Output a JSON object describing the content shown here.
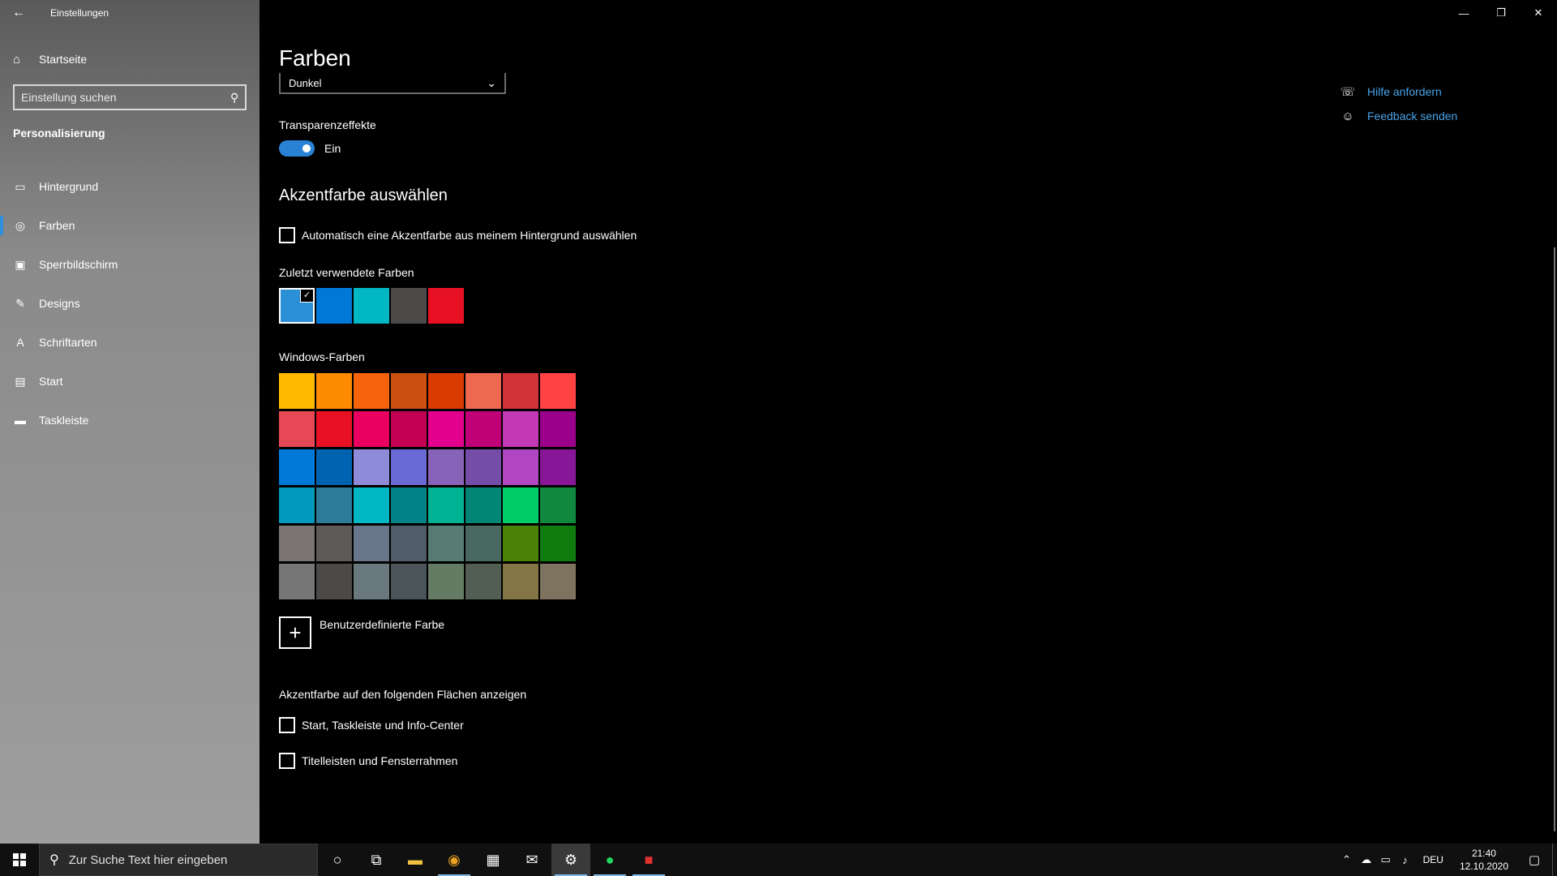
{
  "window": {
    "title": "Einstellungen",
    "controls": {
      "minimize": "—",
      "restore": "❐",
      "close": "✕"
    }
  },
  "sidebar": {
    "home_label": "Startseite",
    "search_placeholder": "Einstellung suchen",
    "section_heading": "Personalisierung",
    "items": [
      {
        "label": "Hintergrund",
        "icon": "image-icon",
        "glyph": "▭"
      },
      {
        "label": "Farben",
        "icon": "palette-icon",
        "glyph": "◎",
        "active": true
      },
      {
        "label": "Sperrbildschirm",
        "icon": "lock-screen-icon",
        "glyph": "▣"
      },
      {
        "label": "Designs",
        "icon": "brush-icon",
        "glyph": "✎"
      },
      {
        "label": "Schriftarten",
        "icon": "font-icon",
        "glyph": "A"
      },
      {
        "label": "Start",
        "icon": "start-icon",
        "glyph": "▤"
      },
      {
        "label": "Taskleiste",
        "icon": "taskbar-icon",
        "glyph": "▬"
      }
    ]
  },
  "main": {
    "title": "Farben",
    "mode_dropdown": {
      "value": "Dunkel"
    },
    "transparency": {
      "label": "Transparenzeffekte",
      "state_label": "Ein",
      "on": true
    },
    "accent_heading": "Akzentfarbe auswählen",
    "auto_accent_label": "Automatisch eine Akzentfarbe aus meinem Hintergrund auswählen",
    "recent_label": "Zuletzt verwendete Farben",
    "recent_colors": [
      "#2b8fd6",
      "#0078d7",
      "#00b7c3",
      "#4c4a48",
      "#e81123"
    ],
    "windows_colors_label": "Windows-Farben",
    "windows_colors": [
      "#ffb900",
      "#ff8c00",
      "#f7630c",
      "#ca5010",
      "#da3b01",
      "#ef6950",
      "#d13438",
      "#ff4343",
      "#e74856",
      "#e81123",
      "#ea005e",
      "#c30052",
      "#e3008c",
      "#bf0077",
      "#c239b3",
      "#9a0089",
      "#0078d7",
      "#0063b1",
      "#8e8cd8",
      "#6b69d6",
      "#8764b8",
      "#744da9",
      "#b146c2",
      "#881798",
      "#0099bc",
      "#2d7d9a",
      "#00b7c3",
      "#038387",
      "#00b294",
      "#018574",
      "#00cc6a",
      "#10893e",
      "#7a7574",
      "#5d5a58",
      "#68768a",
      "#515c6b",
      "#567c73",
      "#486860",
      "#498205",
      "#107c10",
      "#767676",
      "#4c4a48",
      "#69797e",
      "#4a5459",
      "#647c64",
      "#525e54",
      "#847545",
      "#7e735f"
    ],
    "custom_color_label": "Benutzerdefinierte Farbe",
    "show_accent_label": "Akzentfarbe auf den folgenden Flächen anzeigen",
    "surfaces": [
      {
        "label": "Start, Taskleiste und Info-Center"
      },
      {
        "label": "Titelleisten und Fensterrahmen"
      }
    ],
    "help_links": [
      {
        "label": "Hilfe anfordern",
        "icon": "help-chat-icon",
        "glyph": "💬"
      },
      {
        "label": "Feedback senden",
        "icon": "feedback-icon",
        "glyph": "👤"
      }
    ]
  },
  "taskbar": {
    "search_placeholder": "Zur Suche Text hier eingeben",
    "language": "DEU",
    "time": "21:40",
    "date": "12.10.2020"
  }
}
